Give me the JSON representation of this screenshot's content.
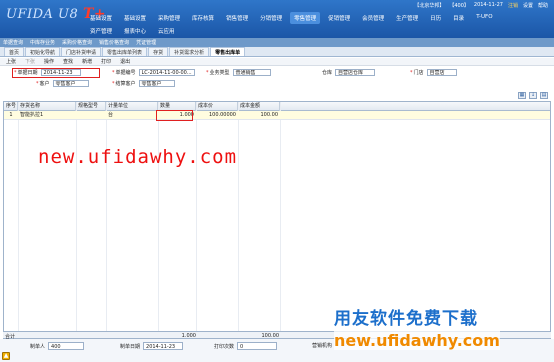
{
  "app": {
    "logo_text": "UFIDA U8",
    "logo_suffix": "T+",
    "utility": [
      "【北京华邦】",
      "【400】",
      "2014-11-27",
      "注销",
      "设置",
      "帮助"
    ]
  },
  "nav": {
    "row1": [
      "基础设置",
      "基础设置",
      "采购管理",
      "库存核算",
      "销售管理",
      "分销管理",
      "零售管理",
      "促销管理",
      "会员管理",
      "生产管理",
      "T-UFO"
    ],
    "row1_more": [
      "日历",
      "目录"
    ],
    "row2": [
      "资产管理",
      "报表中心",
      "云应用"
    ]
  },
  "quickbar": [
    "单据查询",
    "中库存业务",
    "采购价格查询",
    "销售价格查询",
    "凭证管理"
  ],
  "tabs": [
    {
      "label": "首页",
      "active": false
    },
    {
      "label": "初始化导航",
      "active": false
    },
    {
      "label": "门店补货申请",
      "active": false
    },
    {
      "label": "零售出库单列表",
      "active": false
    },
    {
      "label": "存货",
      "active": false
    },
    {
      "label": "补货需求分析",
      "active": false
    },
    {
      "label": "零售出库单",
      "active": true
    }
  ],
  "toolbar": {
    "items": [
      "上张",
      "下张",
      "操作",
      "查找",
      "新增",
      "打印",
      "退出"
    ]
  },
  "form": {
    "date_label": "单据日期",
    "date_value": "2014-11-23",
    "docno_label": "单据编号",
    "docno_value": "LC-2014-11-00-00...",
    "biztype_label": "业务类型",
    "biztype_value": "普通销售",
    "warehouse_label": "仓库",
    "warehouse_value": "自营店仓库",
    "store_label": "门店",
    "store_value": "自营店",
    "customer_label": "客户",
    "customer_value": "零售客户",
    "settle_label": "结算客户",
    "settle_value": "零售客户"
  },
  "table": {
    "headers": [
      "序号",
      "存货名称",
      "规格型号",
      "计量单位",
      "数量",
      "成本价",
      "成本金额"
    ],
    "rows": [
      {
        "seq": "1",
        "name": "智能扒拉1",
        "spec": "",
        "unit": "台",
        "qty": "1.000",
        "price": "100.00000",
        "amount": "100.00"
      }
    ]
  },
  "watermark_top": "new.ufidawhy.com",
  "totals": {
    "label": "合计",
    "qty": "1.000",
    "amount": "100.00"
  },
  "footer": {
    "maker_label": "制单人",
    "maker_value": "400",
    "date_label": "制单日期",
    "date_value": "2014-11-23",
    "print_label": "打印次数",
    "print_value": "0",
    "org_label": "营销机构"
  },
  "overlay": {
    "cn_text": "用友软件免费下载",
    "url_text": "new.ufidawhy.com"
  }
}
